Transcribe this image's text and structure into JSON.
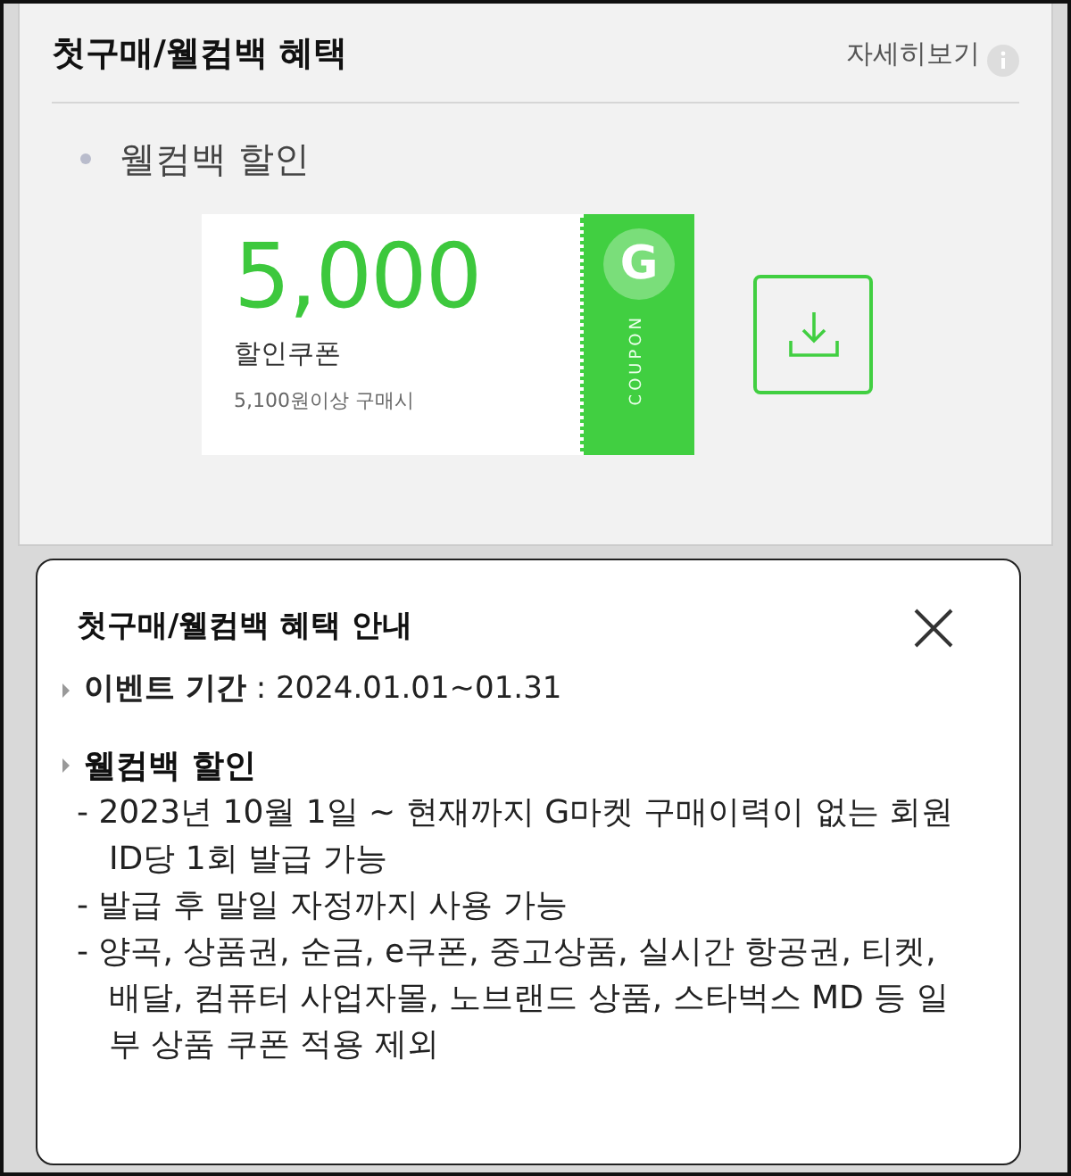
{
  "panel": {
    "title": "첫구매/웰컴백 혜택",
    "more_link": "자세히보기",
    "section_label": "웰컴백 할인",
    "coupon": {
      "amount": "5,000",
      "name": "할인쿠폰",
      "condition": "5,100원이상 구매시",
      "stub_logo": "G",
      "stub_text": "COUPON"
    }
  },
  "popup": {
    "title": "첫구매/웰컴백 혜택 안내",
    "sections": [
      {
        "kind": "line",
        "text": "**이벤트 기간** : 2024.01.01~01.31"
      },
      {
        "kind": "list",
        "heading": "웰컴백 할인",
        "items": [
          "- 2023년 10월 1일 ~ 현재까지 G마켓 구매이력이 없는 회원 ID당 1회 발급 가능",
          "- 발급 후 말일 자정까지 사용 가능",
          "- 양곡, 상품권, 순금, e쿠폰, 중고상품, 실시간 항공권, 티켓, 배달, 컴퓨터 사업자몰, 노브랜드 상품, 스타벅스 MD 등 일부 상품 쿠폰 적용 제외"
        ]
      }
    ]
  }
}
